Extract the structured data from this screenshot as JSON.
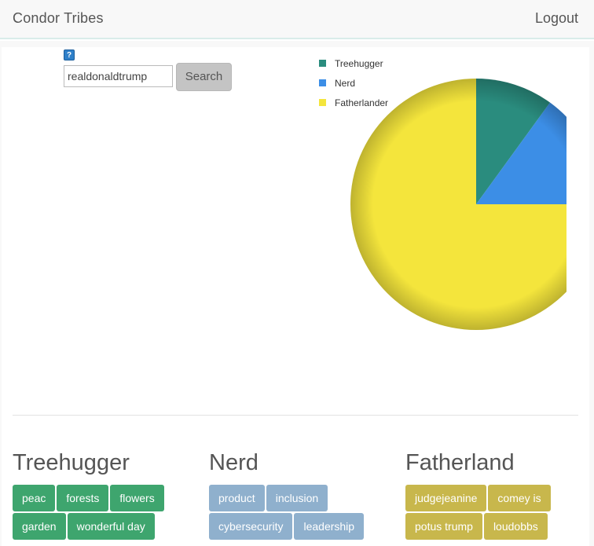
{
  "navbar": {
    "brand": "Condor Tribes",
    "logout_label": "Logout"
  },
  "search": {
    "help_icon": "help-icon",
    "help_glyph": "?",
    "value": "realdonaldtrump",
    "button_label": "Search"
  },
  "chart_data": {
    "type": "pie",
    "title": "",
    "legend_position": "top-left",
    "labels": [
      "Treehugger",
      "Nerd",
      "Fatherlander"
    ],
    "values": [
      10,
      15,
      75
    ],
    "colors": [
      "#2a8c7e",
      "#3c8ee6",
      "#f4e53c"
    ]
  },
  "tribes": [
    {
      "name": "Treehugger",
      "color": "#3ea56e",
      "tags": [
        "peac",
        "forests",
        "flowers",
        "garden",
        "wonderful day"
      ]
    },
    {
      "name": "Nerd",
      "color": "#8fb0cd",
      "tags": [
        "product",
        "inclusion",
        "cybersecurity",
        "leadership"
      ]
    },
    {
      "name": "Fatherland",
      "color": "#c8b74c",
      "tags": [
        "judgejeanine",
        "comey is",
        "potus trump",
        "loudobbs"
      ]
    }
  ]
}
